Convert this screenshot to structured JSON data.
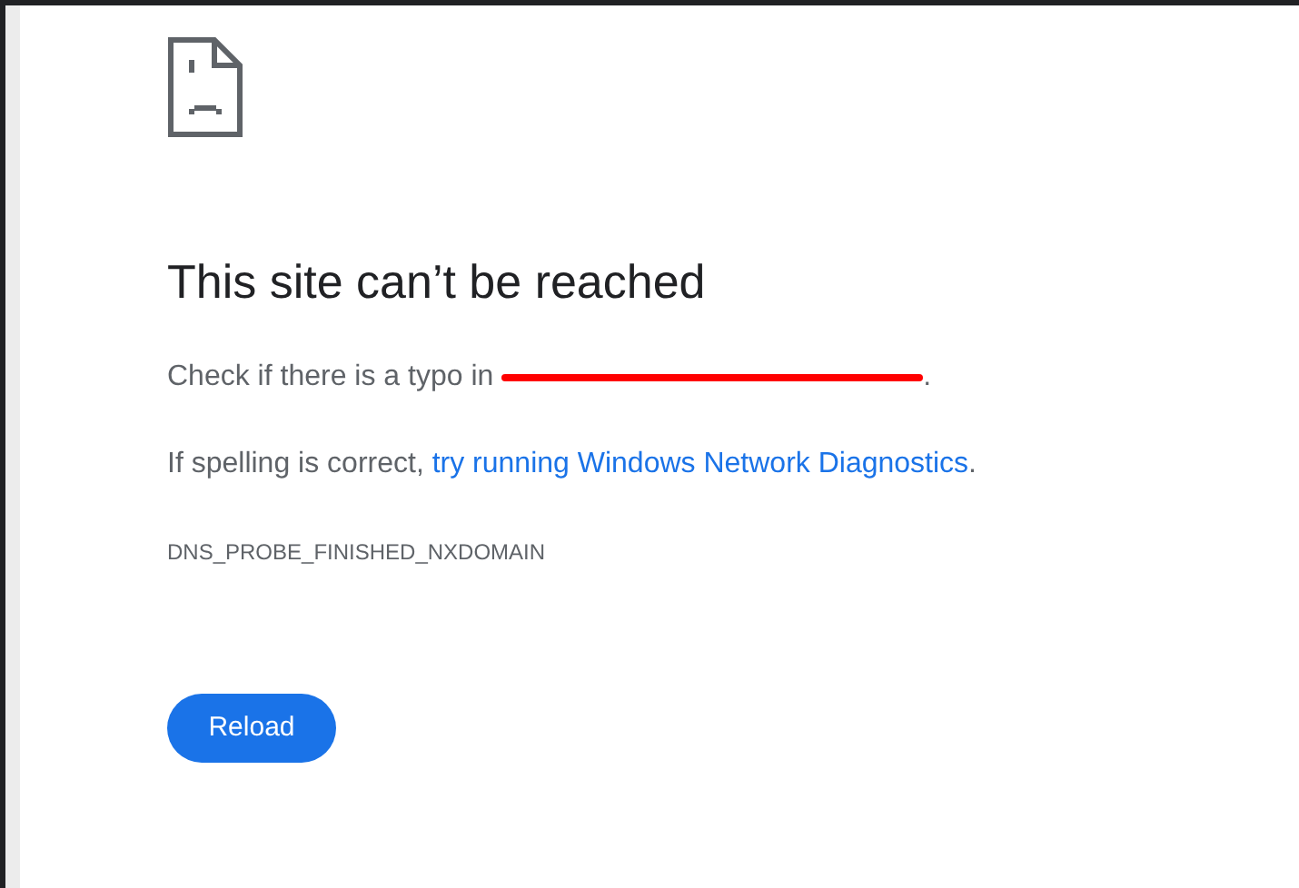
{
  "heading": "This site can’t be reached",
  "typo_line": {
    "before": "Check if there is a typo in ",
    "domain_redacted": true,
    "after": "."
  },
  "suggestion": {
    "before": "If spelling is correct, ",
    "link": "try running Windows Network Diagnostics",
    "after": "."
  },
  "error_code": "DNS_PROBE_FINISHED_NXDOMAIN",
  "button": "Reload"
}
